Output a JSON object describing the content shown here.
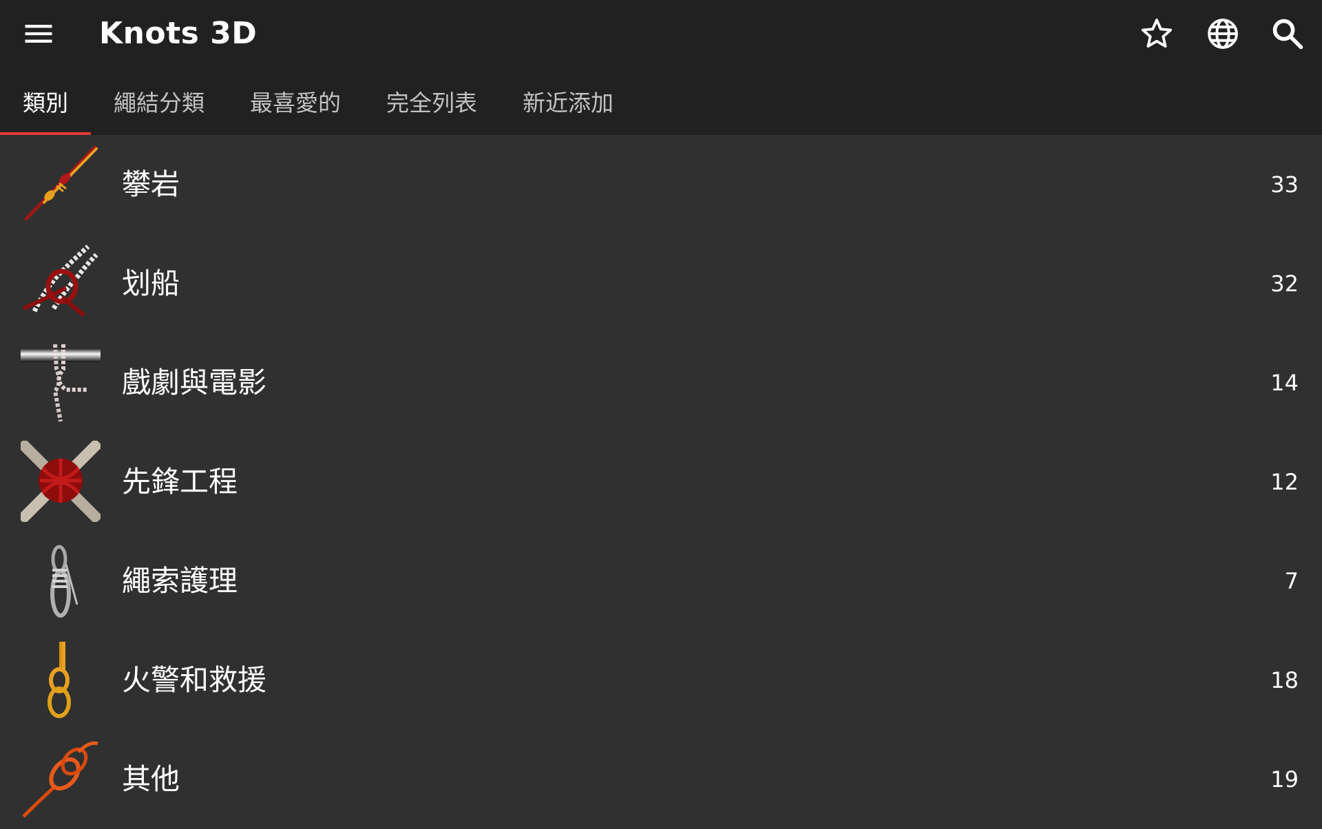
{
  "app": {
    "title": "Knots 3D"
  },
  "toolbar": {
    "menu_icon": "menu-icon",
    "favorite_icon": "star-outline-icon",
    "language_icon": "globe-icon",
    "search_icon": "search-icon"
  },
  "tabs": [
    {
      "label": "類別",
      "active": true
    },
    {
      "label": "繩結分類",
      "active": false
    },
    {
      "label": "最喜愛的",
      "active": false
    },
    {
      "label": "完全列表",
      "active": false
    },
    {
      "label": "新近添加",
      "active": false
    }
  ],
  "categories": [
    {
      "label": "攀岩",
      "count": "33",
      "icon": "climbing-knot-thumbnail"
    },
    {
      "label": "划船",
      "count": "32",
      "icon": "boating-knot-thumbnail"
    },
    {
      "label": "戲劇與電影",
      "count": "14",
      "icon": "theater-knot-thumbnail"
    },
    {
      "label": "先鋒工程",
      "count": "12",
      "icon": "pioneering-lashing-thumbnail"
    },
    {
      "label": "繩索護理",
      "count": "7",
      "icon": "rope-care-coil-thumbnail"
    },
    {
      "label": "火警和救援",
      "count": "18",
      "icon": "fire-rescue-knot-thumbnail"
    },
    {
      "label": "其他",
      "count": "19",
      "icon": "other-knot-thumbnail"
    }
  ],
  "colors": {
    "appbar": "#212121",
    "background": "#303030",
    "tab_indicator": "#e53935"
  }
}
